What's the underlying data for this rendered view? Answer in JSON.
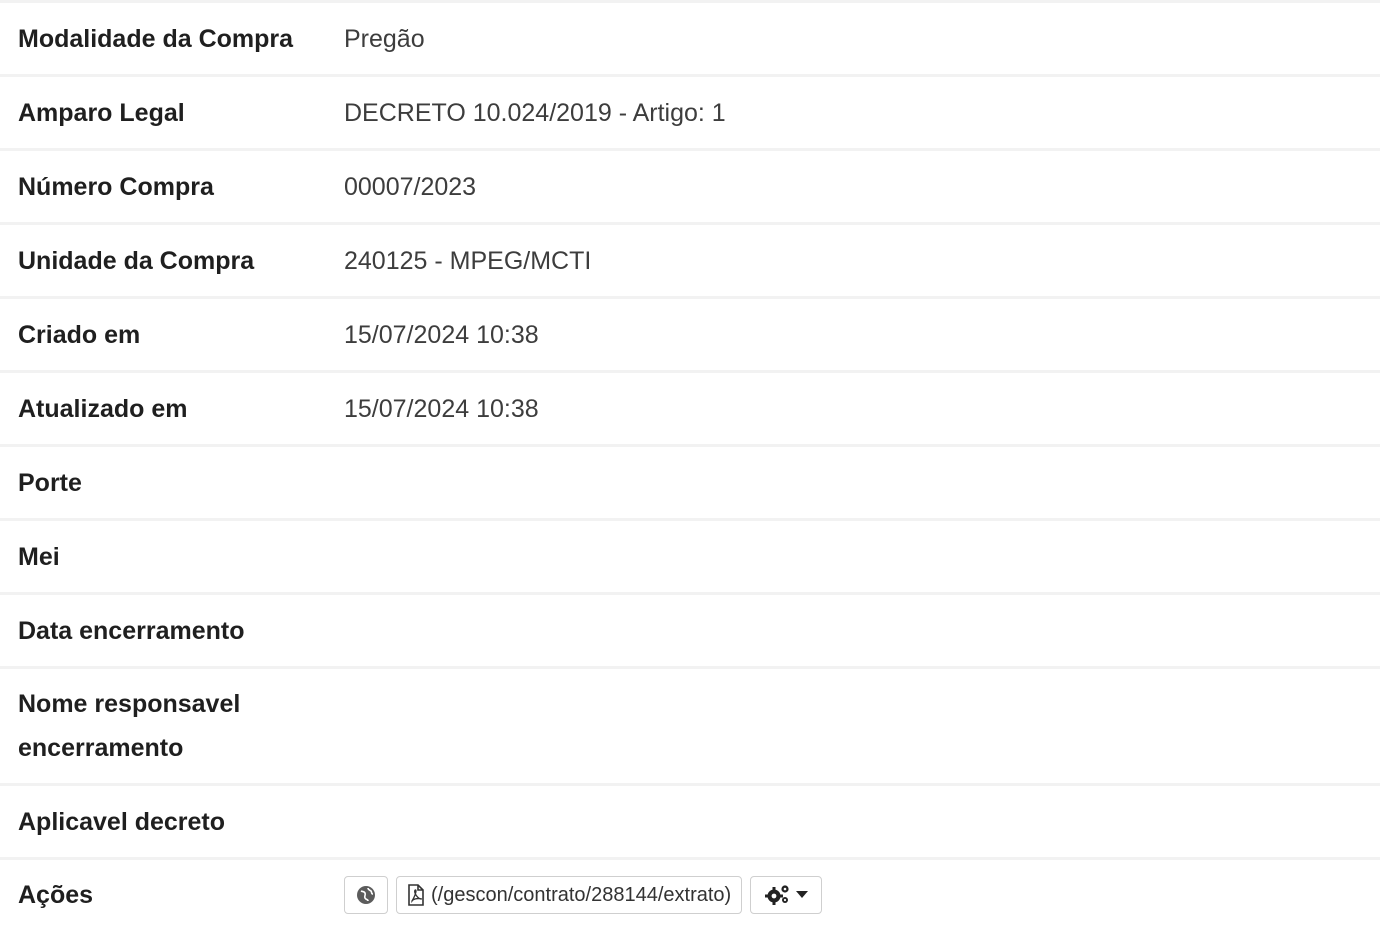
{
  "rows": [
    {
      "label": "Modalidade da Compra",
      "value": "Pregão"
    },
    {
      "label": "Amparo Legal",
      "value": "DECRETO 10.024/2019 - Artigo: 1"
    },
    {
      "label": "Número Compra",
      "value": "00007/2023"
    },
    {
      "label": "Unidade da Compra",
      "value": "240125 - MPEG/MCTI"
    },
    {
      "label": "Criado em",
      "value": "15/07/2024 10:38"
    },
    {
      "label": "Atualizado em",
      "value": "15/07/2024 10:38"
    },
    {
      "label": "Porte",
      "value": ""
    },
    {
      "label": "Mei",
      "value": ""
    },
    {
      "label": "Data encerramento",
      "value": ""
    },
    {
      "label": "Nome responsavel encerramento",
      "value": ""
    },
    {
      "label": "Aplicavel decreto",
      "value": ""
    }
  ],
  "actions": {
    "label": "Ações",
    "globe_icon": "globe-icon",
    "pdf_icon": "file-pdf-icon",
    "pdf_link_text": "(/gescon/contrato/288144/extrato)",
    "cogs_icon": "cogs-icon",
    "caret_icon": "caret-down-icon"
  }
}
